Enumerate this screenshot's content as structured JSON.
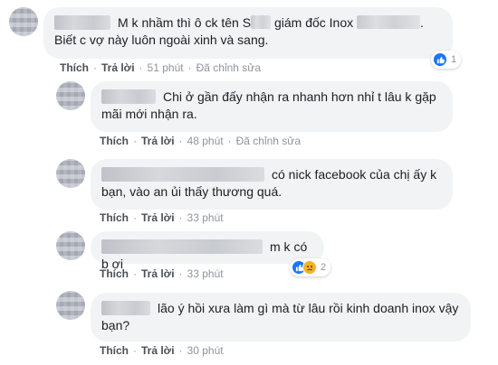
{
  "comments": [
    {
      "text_part1": "M k nhầm thì ô ck tên S",
      "text_part2": "giám đốc Inox",
      "text_part3": ". Biết c vợ này luôn ngoài xinh và sang.",
      "like": "Thích",
      "reply": "Trả lời",
      "time": "51 phút",
      "edited": "Đã chỉnh sửa",
      "reaction_icons": [
        "like-icon"
      ],
      "reaction_count": "1"
    },
    {
      "text": "Chi ở gần đấy nhận ra nhanh hơn nhỉ t lâu k gặp mãi mới nhận ra.",
      "like": "Thích",
      "reply": "Trả lời",
      "time": "48 phút",
      "edited": "Đã chỉnh sửa"
    },
    {
      "text": "có nick facebook của chị ấy k bạn, vào an ủi thấy thương quá.",
      "like": "Thích",
      "reply": "Trả lời",
      "time": "33 phút"
    },
    {
      "text": "m k có b ơi",
      "like": "Thích",
      "reply": "Trả lời",
      "time": "33 phút",
      "reaction_icons": [
        "like-icon",
        "sad-icon"
      ],
      "reaction_count": "2"
    },
    {
      "text": "lão ý hồi xưa làm gì mà từ lâu rồi kinh doanh inox vậy bạn?",
      "like": "Thích",
      "reply": "Trả lời",
      "time": "30 phút"
    }
  ],
  "separator": "·",
  "colors": {
    "bubble_bg": "#f2f3f5",
    "meta_text": "#90949c",
    "like_blue": "#1877f2",
    "sad_yellow": "#f7b125"
  }
}
